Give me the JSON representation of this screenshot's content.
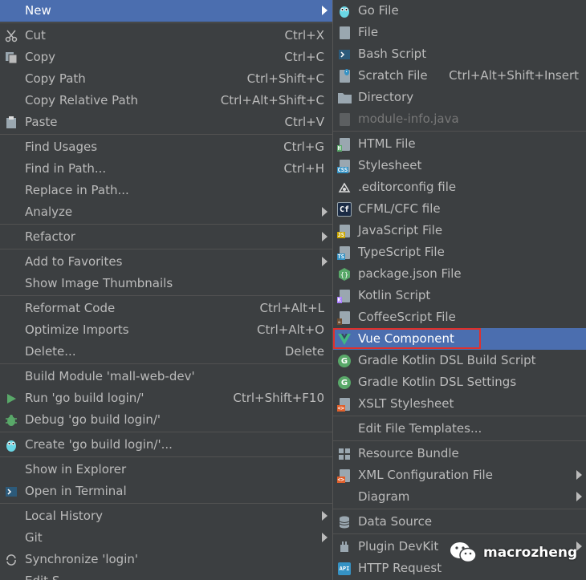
{
  "main_menu": [
    {
      "label": "New",
      "shortcut": "",
      "submenu": true,
      "highlighted": true,
      "icon": ""
    },
    {
      "sep": true
    },
    {
      "label": "Cut",
      "shortcut": "Ctrl+X",
      "icon": "scissors-icon"
    },
    {
      "label": "Copy",
      "shortcut": "Ctrl+C",
      "icon": "copy-icon"
    },
    {
      "label": "Copy Path",
      "shortcut": "Ctrl+Shift+C",
      "icon": ""
    },
    {
      "label": "Copy Relative Path",
      "shortcut": "Ctrl+Alt+Shift+C",
      "icon": ""
    },
    {
      "label": "Paste",
      "shortcut": "Ctrl+V",
      "icon": "clipboard-icon"
    },
    {
      "sep": true
    },
    {
      "label": "Find Usages",
      "shortcut": "Ctrl+G",
      "icon": ""
    },
    {
      "label": "Find in Path...",
      "shortcut": "Ctrl+H",
      "icon": ""
    },
    {
      "label": "Replace in Path...",
      "shortcut": "",
      "icon": ""
    },
    {
      "label": "Analyze",
      "shortcut": "",
      "submenu": true,
      "icon": ""
    },
    {
      "sep": true
    },
    {
      "label": "Refactor",
      "shortcut": "",
      "submenu": true,
      "icon": ""
    },
    {
      "sep": true
    },
    {
      "label": "Add to Favorites",
      "shortcut": "",
      "submenu": true,
      "icon": ""
    },
    {
      "label": "Show Image Thumbnails",
      "shortcut": "",
      "icon": ""
    },
    {
      "sep": true
    },
    {
      "label": "Reformat Code",
      "shortcut": "Ctrl+Alt+L",
      "icon": ""
    },
    {
      "label": "Optimize Imports",
      "shortcut": "Ctrl+Alt+O",
      "icon": ""
    },
    {
      "label": "Delete...",
      "shortcut": "Delete",
      "icon": ""
    },
    {
      "sep": true
    },
    {
      "label": "Build Module 'mall-web-dev'",
      "shortcut": "",
      "icon": ""
    },
    {
      "label": "Run 'go build login/'",
      "shortcut": "Ctrl+Shift+F10",
      "icon": "run-icon"
    },
    {
      "label": "Debug 'go build login/'",
      "shortcut": "",
      "icon": "debug-icon"
    },
    {
      "sep": true
    },
    {
      "label": "Create 'go build login/'...",
      "shortcut": "",
      "icon": "go-gopher-icon"
    },
    {
      "sep": true
    },
    {
      "label": "Show in Explorer",
      "shortcut": "",
      "icon": ""
    },
    {
      "label": "Open in Terminal",
      "shortcut": "",
      "icon": "terminal-icon"
    },
    {
      "sep": true
    },
    {
      "label": "Local History",
      "shortcut": "",
      "submenu": true,
      "icon": ""
    },
    {
      "label": "Git",
      "shortcut": "",
      "submenu": true,
      "icon": ""
    },
    {
      "label": "Synchronize 'login'",
      "shortcut": "",
      "icon": "sync-icon"
    },
    {
      "label": "Edit S...",
      "shortcut": "",
      "icon": ""
    }
  ],
  "sub_menu": [
    {
      "label": "Go File",
      "icon": "go-gopher-icon"
    },
    {
      "label": "File",
      "icon": "file-icon"
    },
    {
      "label": "Bash Script",
      "icon": "terminal-icon"
    },
    {
      "label": "Scratch File",
      "shortcut": "Ctrl+Alt+Shift+Insert",
      "icon": "scratch-file-icon"
    },
    {
      "label": "Directory",
      "icon": "folder-icon"
    },
    {
      "label": "module-info.java",
      "disabled": true,
      "icon": "java-module-icon"
    },
    {
      "sep": true
    },
    {
      "label": "HTML File",
      "icon": "html-file-icon"
    },
    {
      "label": "Stylesheet",
      "icon": "css-file-icon"
    },
    {
      "label": ".editorconfig file",
      "icon": "editorconfig-icon"
    },
    {
      "label": "CFML/CFC file",
      "icon": "cfml-icon"
    },
    {
      "label": "JavaScript File",
      "icon": "js-file-icon"
    },
    {
      "label": "TypeScript File",
      "icon": "ts-file-icon"
    },
    {
      "label": "package.json File",
      "icon": "nodejs-icon"
    },
    {
      "label": "Kotlin Script",
      "icon": "kotlin-icon"
    },
    {
      "label": "CoffeeScript File",
      "icon": "coffeescript-icon"
    },
    {
      "label": "Vue Component",
      "highlighted": true,
      "boxed": true,
      "icon": "vue-icon"
    },
    {
      "label": "Gradle Kotlin DSL Build Script",
      "icon": "gradle-icon"
    },
    {
      "label": "Gradle Kotlin DSL Settings",
      "icon": "gradle-icon"
    },
    {
      "label": "XSLT Stylesheet",
      "icon": "xslt-icon"
    },
    {
      "sep": true
    },
    {
      "label": "Edit File Templates...",
      "icon": ""
    },
    {
      "sep": true
    },
    {
      "label": "Resource Bundle",
      "icon": "resource-bundle-icon"
    },
    {
      "label": "XML Configuration File",
      "submenu": true,
      "icon": "xml-file-icon"
    },
    {
      "label": "Diagram",
      "submenu": true,
      "icon": ""
    },
    {
      "sep": true
    },
    {
      "label": "Data Source",
      "icon": "database-icon"
    },
    {
      "sep": true
    },
    {
      "label": "Plugin DevKit",
      "submenu": true,
      "icon": "plugin-icon"
    },
    {
      "label": "HTTP Request",
      "icon": "api-icon"
    }
  ],
  "watermark": {
    "text": "macrozheng",
    "icon": "wechat-icon"
  },
  "colors": {
    "highlight": "#4b6eaf",
    "menu_bg": "#3c3f41",
    "text": "#bbbbbb",
    "box_red": "#e0302c"
  }
}
